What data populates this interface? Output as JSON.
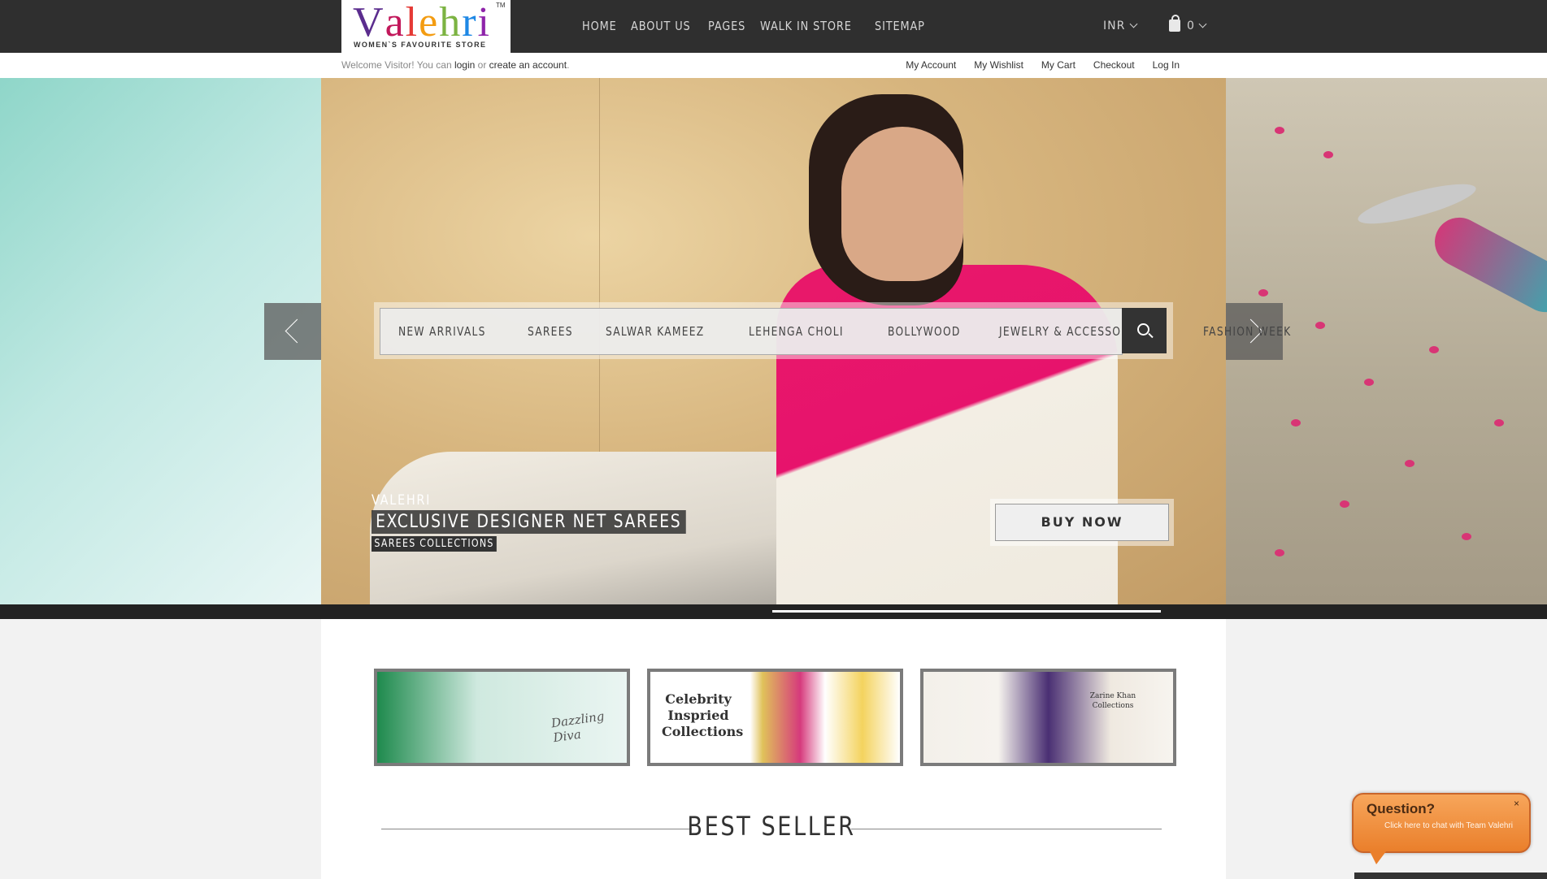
{
  "brand": {
    "logo_text": "Valehri",
    "logo_letters": [
      "V",
      "a",
      "l",
      "e",
      "h",
      "r",
      "i"
    ],
    "logo_colors": [
      "#5b2d8e",
      "#c2185b",
      "#e53935",
      "#f39c12",
      "#7cb342",
      "#1e88e5",
      "#8e24aa"
    ],
    "tagline": "WOMEN`S FAVOURITE STORE",
    "tm": "TM"
  },
  "nav": {
    "items": [
      "HOME",
      "ABOUT US",
      "PAGES",
      "WALK IN STORE",
      "SITEMAP"
    ],
    "currency": "INR",
    "cart_count": "0"
  },
  "welcome": {
    "prefix": "Welcome Visitor! You can ",
    "login": "login",
    "or": " or ",
    "create": "create an account",
    "suffix": "."
  },
  "account_links": [
    "My Account",
    "My Wishlist",
    "My Cart",
    "Checkout",
    "Log In"
  ],
  "categories": [
    "NEW ARRIVALS",
    "SAREES",
    "SALWAR KAMEEZ",
    "LEHENGA CHOLI",
    "BOLLYWOOD",
    "JEWELRY & ACCESSORIES",
    "FASHION WEEK"
  ],
  "slide": {
    "brand": "VALEHRI",
    "title": "EXCLUSIVE DESIGNER NET SAREES",
    "subtitle": "SAREES COLLECTIONS",
    "cta": "BUY NOW"
  },
  "banners": [
    {
      "text": "Dazzling Diva"
    },
    {
      "text": "Celebrity Inspried Collections"
    },
    {
      "text": "Zarine Khan Collections"
    }
  ],
  "best_seller_title": "BEST SELLER",
  "chat": {
    "title": "Question?",
    "subtitle": "Click here to chat with Team Valehri",
    "close": "×"
  },
  "colors": {
    "topbar": "#2f2f2f",
    "accent_pink": "#e7136c",
    "chat_orange": "#ea7f2b"
  }
}
